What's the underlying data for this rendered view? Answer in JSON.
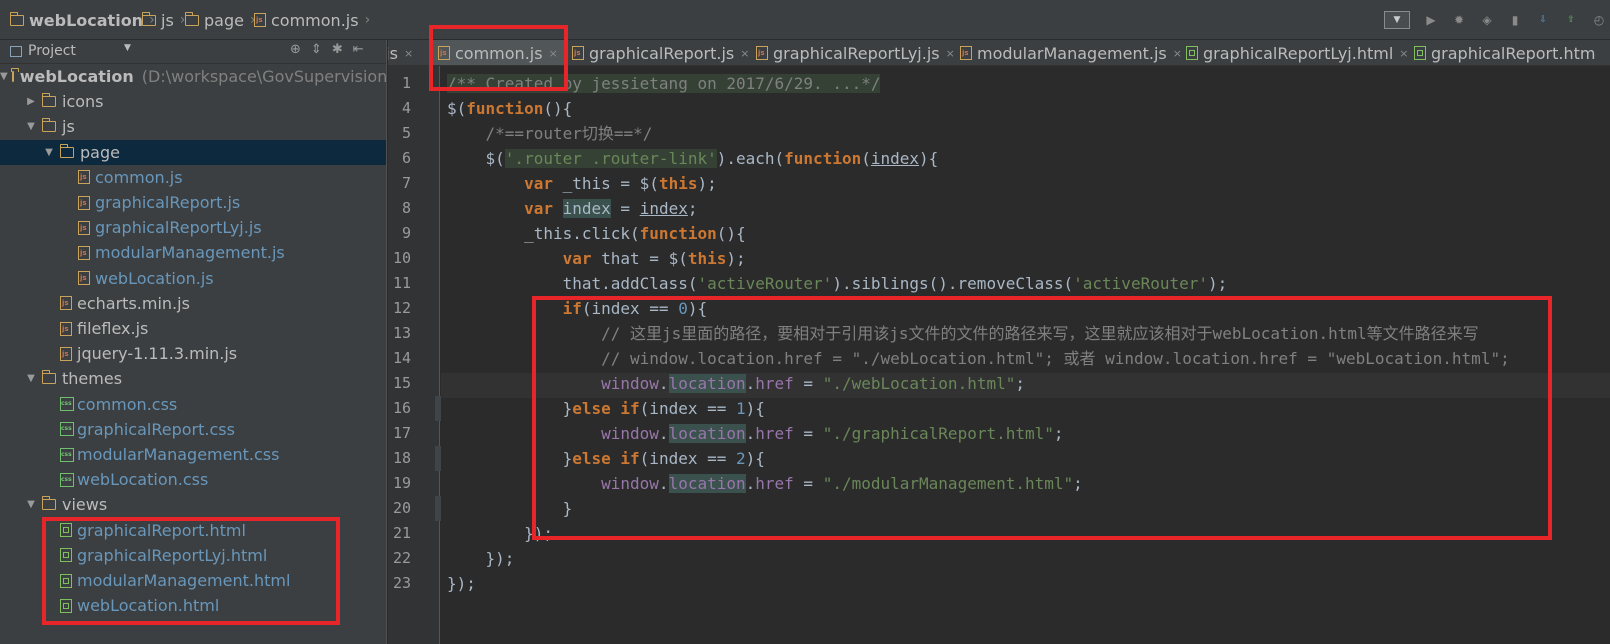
{
  "breadcrumb": [
    "webLocation",
    "js",
    "page",
    "common.js"
  ],
  "project_panel": {
    "title": "Project"
  },
  "tree": [
    {
      "name": "webLocation",
      "path": "(D:\\workspace\\GovSupervisionPl",
      "type": "folder",
      "depth": 0,
      "open": true
    },
    {
      "name": "icons",
      "type": "folder",
      "depth": 1,
      "open": false
    },
    {
      "name": "js",
      "type": "folder",
      "depth": 1,
      "open": true
    },
    {
      "name": "page",
      "type": "folder",
      "depth": 2,
      "open": true,
      "selected": true
    },
    {
      "name": "common.js",
      "type": "js",
      "depth": 3
    },
    {
      "name": "graphicalReport.js",
      "type": "js",
      "depth": 3
    },
    {
      "name": "graphicalReportLyj.js",
      "type": "js",
      "depth": 3
    },
    {
      "name": "modularManagement.js",
      "type": "js",
      "depth": 3
    },
    {
      "name": "webLocation.js",
      "type": "js",
      "depth": 3
    },
    {
      "name": "echarts.min.js",
      "type": "js",
      "depth": 2
    },
    {
      "name": "fileflex.js",
      "type": "js",
      "depth": 2
    },
    {
      "name": "jquery-1.11.3.min.js",
      "type": "js",
      "depth": 2
    },
    {
      "name": "themes",
      "type": "folder",
      "depth": 1,
      "open": true
    },
    {
      "name": "common.css",
      "type": "css",
      "depth": 2
    },
    {
      "name": "graphicalReport.css",
      "type": "css",
      "depth": 2
    },
    {
      "name": "modularManagement.css",
      "type": "css",
      "depth": 2
    },
    {
      "name": "webLocation.css",
      "type": "css",
      "depth": 2
    },
    {
      "name": "views",
      "type": "folder",
      "depth": 1,
      "open": true
    },
    {
      "name": "graphicalReport.html",
      "type": "html",
      "depth": 2
    },
    {
      "name": "graphicalReportLyj.html",
      "type": "html",
      "depth": 2
    },
    {
      "name": "modularManagement.html",
      "type": "html",
      "depth": 2
    },
    {
      "name": "webLocation.html",
      "type": "html",
      "depth": 2
    }
  ],
  "tabs": [
    {
      "label": "n.js",
      "type": "js",
      "active": false
    },
    {
      "label": "common.js",
      "type": "js",
      "active": true
    },
    {
      "label": "graphicalReport.js",
      "type": "js",
      "active": false
    },
    {
      "label": "graphicalReportLyj.js",
      "type": "js",
      "active": false
    },
    {
      "label": "modularManagement.js",
      "type": "js",
      "active": false
    },
    {
      "label": "graphicalReportLyj.html",
      "type": "html",
      "active": false
    },
    {
      "label": "graphicalReport.htm",
      "type": "html",
      "active": false
    }
  ],
  "line_numbers": [
    "1",
    "4",
    "5",
    "6",
    "7",
    "8",
    "9",
    "10",
    "11",
    "12",
    "13",
    "14",
    "15",
    "16",
    "17",
    "18",
    "19",
    "20",
    "21",
    "22",
    "23"
  ],
  "code": {
    "l1": "/** Created by jessietang on 2017/6/29. ...*/",
    "l5": "/*==router切换==*/",
    "l13": "// 这里js里面的路径，要相对于引用该js文件的文件的路径来写，这里就应该相对于webLocation.html等文件路径来写",
    "l14": "// window.location.href = \"./webLocation.html\"; 或者 window.location.href = \"webLocation.html\";",
    "s_router": "'.router .router-link'",
    "s_active1": "'activeRouter'",
    "s_active2": "'activeRouter'",
    "s_href15": "\"./webLocation.html\"",
    "s_href17": "\"./graphicalReport.html\"",
    "s_href19": "\"./modularManagement.html\"",
    "n0": "0",
    "n1": "1",
    "n2": "2"
  },
  "colors": {
    "annotation": "#e8262a",
    "keyword": "#cc7832",
    "string": "#6a8759",
    "comment": "#808080",
    "number": "#6897bb",
    "property": "#9876aa"
  }
}
